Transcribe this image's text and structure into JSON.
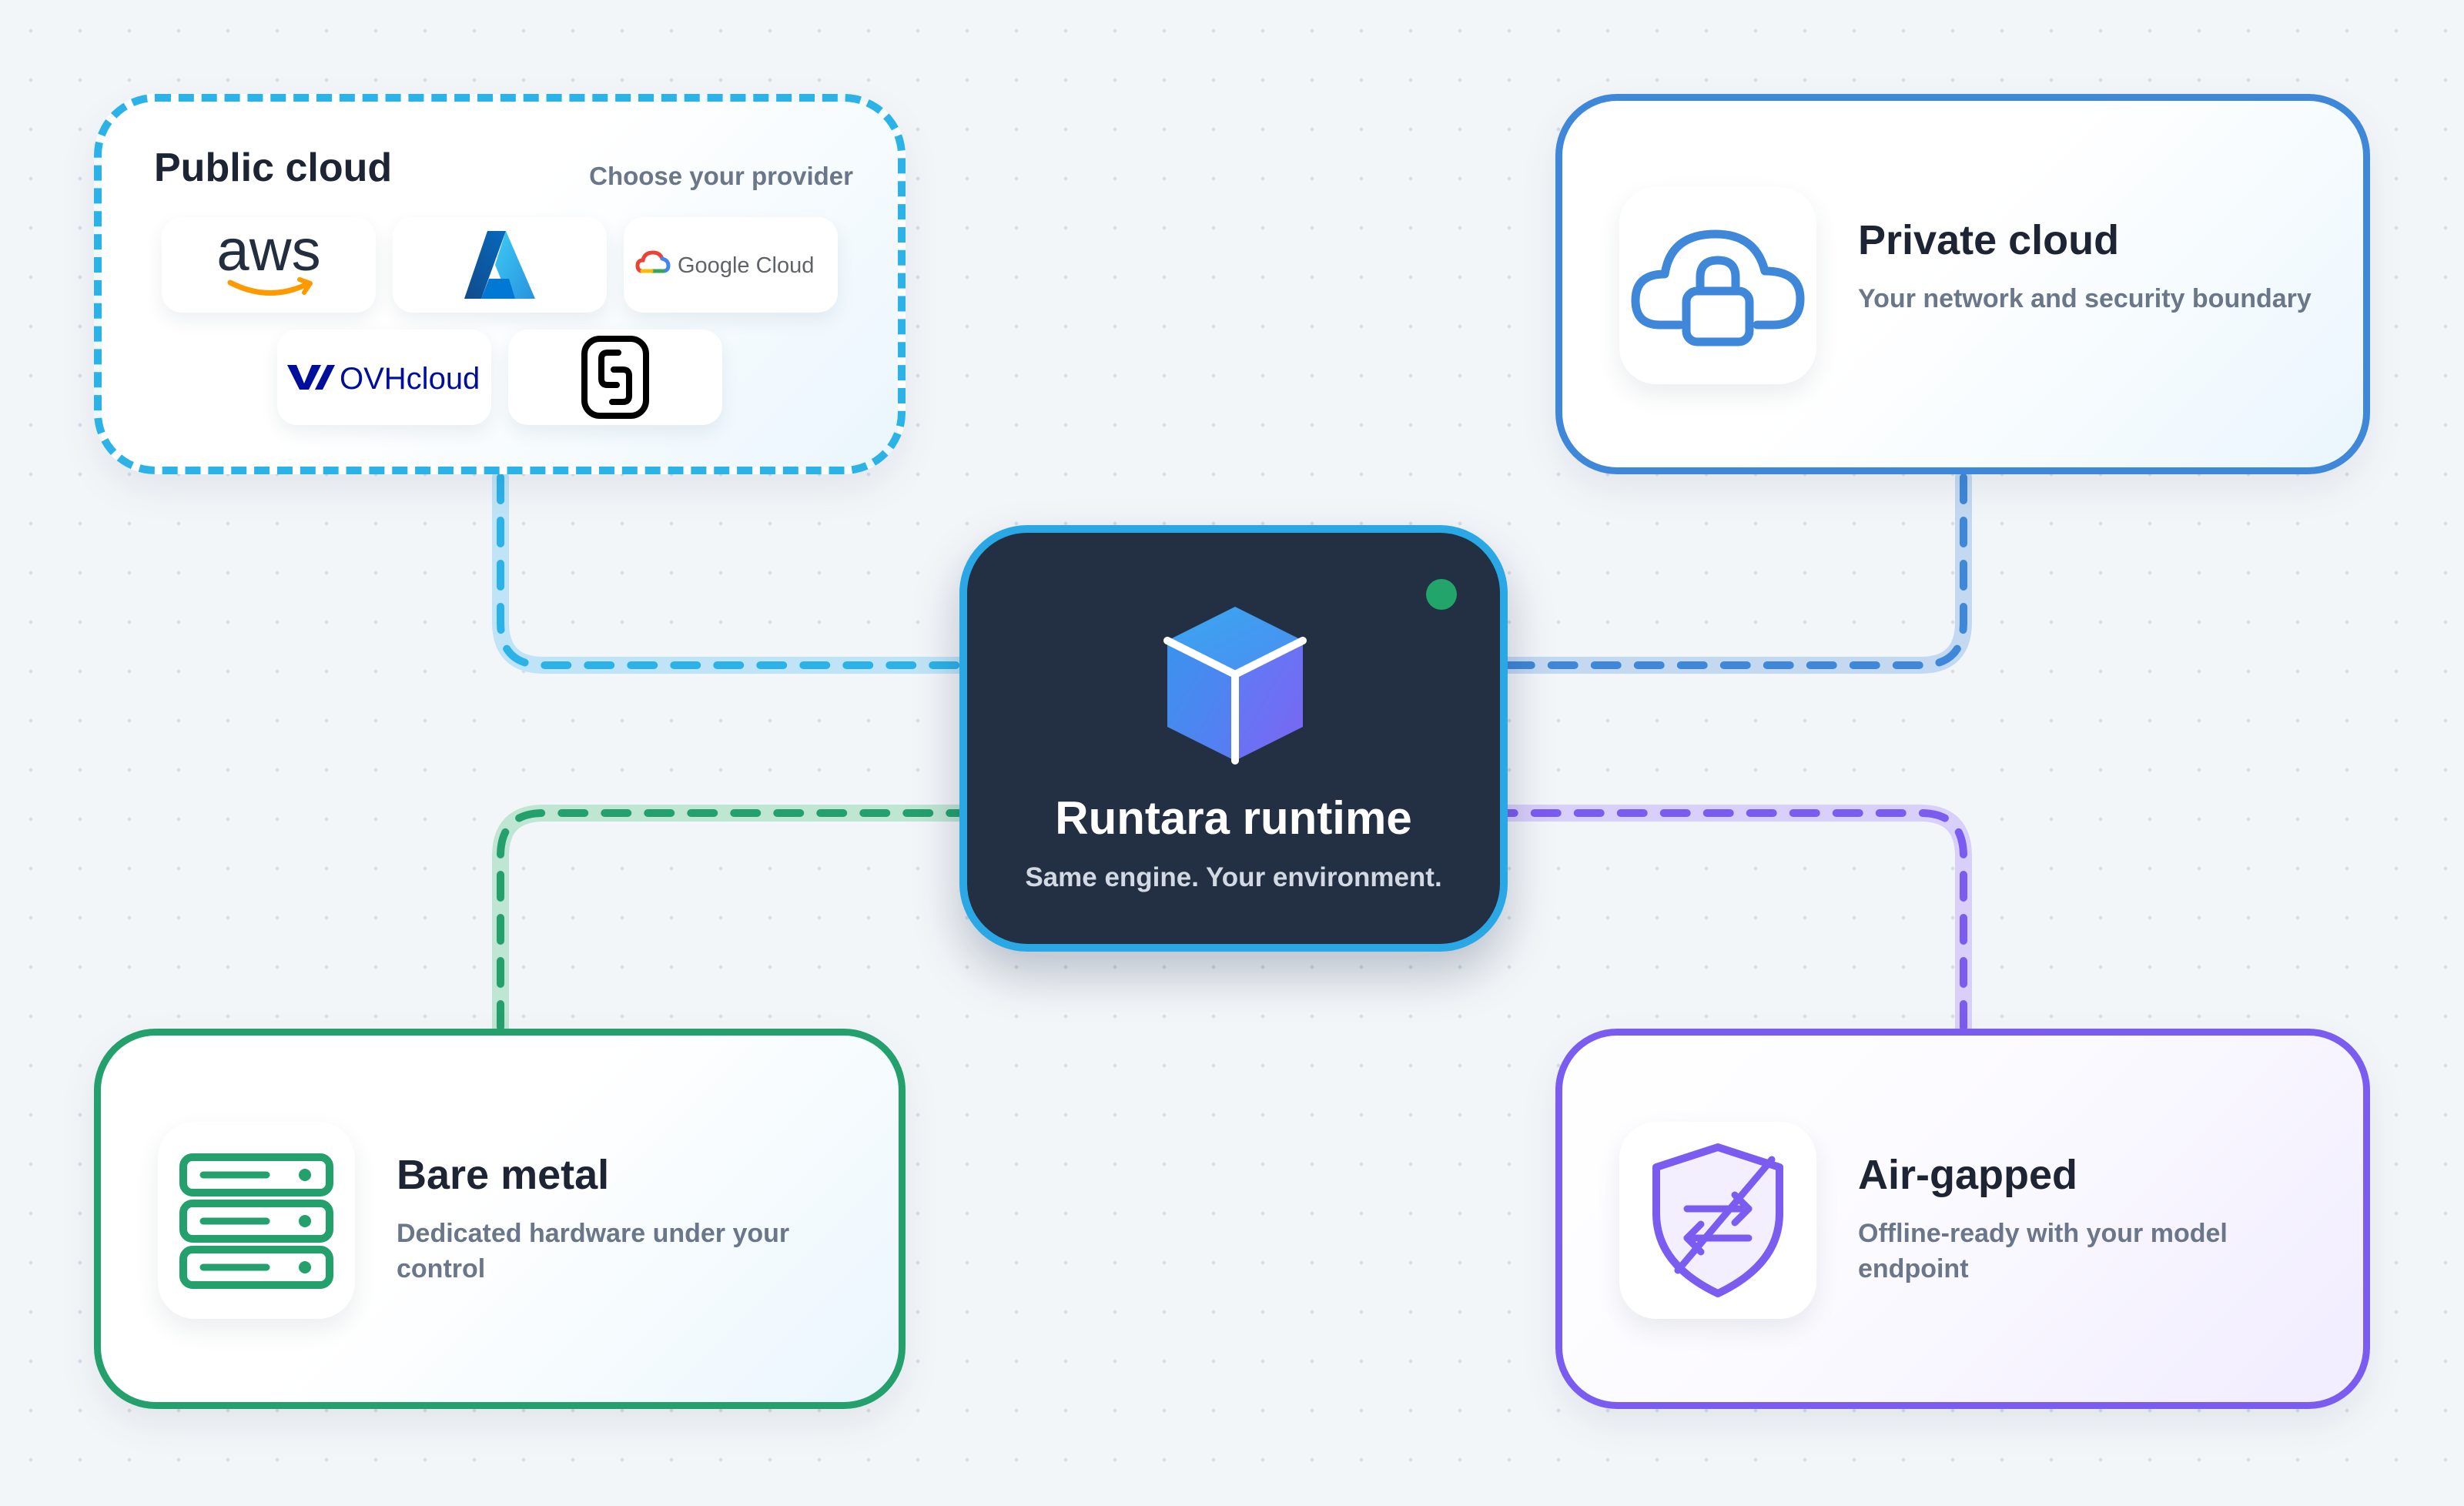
{
  "center": {
    "title": "Runtara runtime",
    "subtitle": "Same engine. Your environment."
  },
  "public_cloud": {
    "title": "Public cloud",
    "hint": "Choose your provider",
    "providers": {
      "aws": "aws",
      "google": "Google Cloud",
      "ovh": "OVHcloud"
    }
  },
  "private_cloud": {
    "title": "Private cloud",
    "subtitle": "Your network and security boundary"
  },
  "bare_metal": {
    "title": "Bare metal",
    "subtitle": "Dedicated hardware under your control"
  },
  "air_gapped": {
    "title": "Air-gapped",
    "subtitle": "Offline-ready with your model endpoint"
  },
  "colors": {
    "public": "#2bb3e8",
    "private": "#3f87d8",
    "bare": "#24a06d",
    "air": "#7b5cf0",
    "center_bg": "#233043",
    "status_dot": "#22a56a"
  }
}
